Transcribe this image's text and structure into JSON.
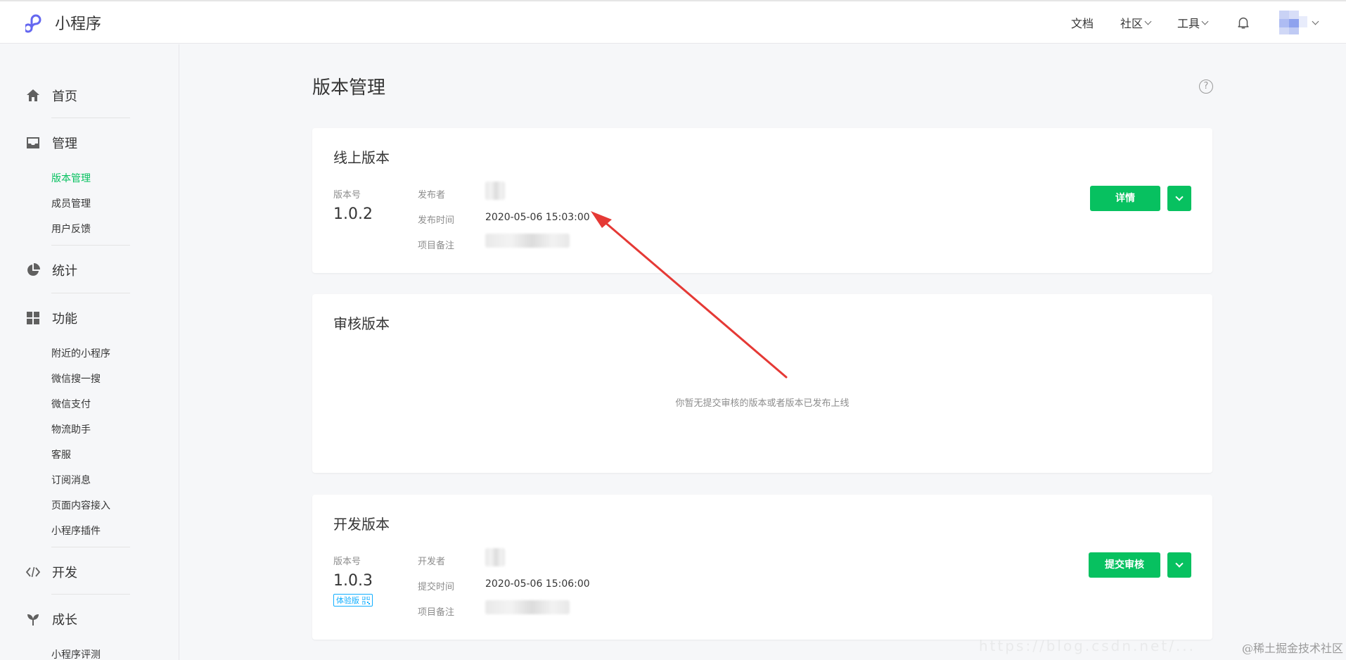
{
  "header": {
    "app_name": "小程序",
    "nav": [
      {
        "label": "文档",
        "has_dropdown": false
      },
      {
        "label": "社区",
        "has_dropdown": true
      },
      {
        "label": "工具",
        "has_dropdown": true
      }
    ],
    "icons": [
      "mini-program-logo-icon",
      "bell-icon",
      "avatar"
    ]
  },
  "sidebar": {
    "groups": [
      {
        "label": "首页",
        "icon": "home-icon",
        "items": []
      },
      {
        "label": "管理",
        "icon": "inbox-icon",
        "items": [
          "版本管理",
          "成员管理",
          "用户反馈"
        ]
      },
      {
        "label": "统计",
        "icon": "pie-chart-icon",
        "items": []
      },
      {
        "label": "功能",
        "icon": "grid-icon",
        "items": [
          "附近的小程序",
          "微信搜一搜",
          "微信支付",
          "物流助手",
          "客服",
          "订阅消息",
          "页面内容接入",
          "小程序插件"
        ]
      },
      {
        "label": "开发",
        "icon": "code-icon",
        "items": []
      },
      {
        "label": "成长",
        "icon": "sprout-icon",
        "items": [
          "小程序评测"
        ]
      }
    ],
    "active_item": "版本管理",
    "accent_color": "#07c160"
  },
  "main": {
    "title": "版本管理",
    "online": {
      "title": "线上版本",
      "version_label": "版本号",
      "version": "1.0.2",
      "publisher_label": "发布者",
      "publish_time_label": "发布时间",
      "publish_time": "2020-05-06 15:03:00",
      "note_label": "项目备注",
      "detail_button": "详情"
    },
    "review": {
      "title": "审核版本",
      "empty_message": "你暂无提交审核的版本或者版本已发布上线"
    },
    "dev": {
      "title": "开发版本",
      "version_label": "版本号",
      "version": "1.0.3",
      "badge": "体验版",
      "developer_label": "开发者",
      "submit_time_label": "提交时间",
      "submit_time": "2020-05-06 15:06:00",
      "note_label": "项目备注",
      "submit_button": "提交审核"
    }
  },
  "watermark": "@稀土掘金技术社区",
  "watermark_url": "https://blog.csdn.net/..."
}
